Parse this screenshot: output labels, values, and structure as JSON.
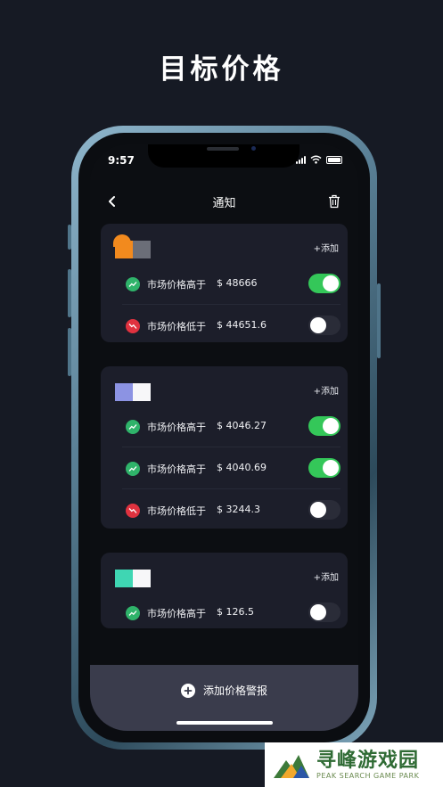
{
  "headline": "目标价格",
  "status_bar": {
    "time": "9:57"
  },
  "nav": {
    "title": "通知"
  },
  "cards": [
    {
      "add_label": "+添加",
      "logo_colors": [
        "#f28a1e",
        "#6b6e78"
      ],
      "alerts": [
        {
          "condition": "市场价格高于",
          "price": "$ 48666",
          "direction": "up",
          "enabled": true
        },
        {
          "condition": "市场价格低于",
          "price": "$ 44651.6",
          "direction": "down",
          "enabled": false
        }
      ]
    },
    {
      "add_label": "+添加",
      "logo_colors": [
        "#8c93e3",
        "#f7f7f9"
      ],
      "alerts": [
        {
          "condition": "市场价格高于",
          "price": "$ 4046.27",
          "direction": "up",
          "enabled": true
        },
        {
          "condition": "市场价格高于",
          "price": "$ 4040.69",
          "direction": "up",
          "enabled": true
        },
        {
          "condition": "市场价格低于",
          "price": "$ 3244.3",
          "direction": "down",
          "enabled": false
        }
      ]
    },
    {
      "add_label": "+添加",
      "logo_colors": [
        "#3fd6b3",
        "#f7f7f9"
      ],
      "alerts": [
        {
          "condition": "市场价格高于",
          "price": "$ 126.5",
          "direction": "up",
          "enabled": false
        }
      ]
    }
  ],
  "bottom_bar": {
    "add_alert_label": "添加价格警报"
  },
  "watermark": {
    "title": "寻峰游戏园",
    "subtitle": "PEAK SEARCH GAME PARK"
  },
  "icons": {
    "back": "chevron-left-icon",
    "trash": "trash-icon",
    "up": "trend-up-icon",
    "down": "trend-down-icon",
    "add": "plus-circle-icon"
  },
  "colors": {
    "toggle_on": "#34c759",
    "trend_up": "#2fb36a",
    "trend_down": "#e0323f",
    "card_bg": "#1c1e2a"
  }
}
